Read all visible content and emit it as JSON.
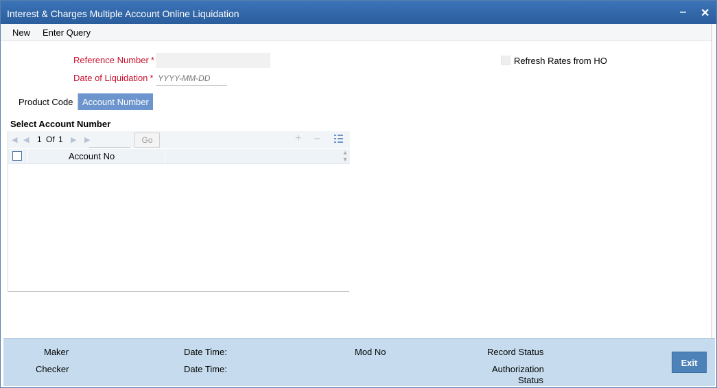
{
  "window": {
    "title": "Interest & Charges Multiple Account Online Liquidation",
    "minimize_label": "‒",
    "close_label": "✕"
  },
  "menu": {
    "new_label": "New",
    "enter_query_label": "Enter Query"
  },
  "form": {
    "reference_number_label": "Reference Number",
    "reference_number_value": "",
    "date_of_liquidation_label": "Date of Liquidation",
    "date_placeholder": "YYYY-MM-DD",
    "required_marker": "*",
    "refresh_rates_label": "Refresh Rates from HO",
    "refresh_rates_checked": false
  },
  "tabs": [
    {
      "label": "Product Code",
      "active": false
    },
    {
      "label": "Account Number",
      "active": true
    }
  ],
  "account_section": {
    "title": "Select Account Number",
    "pager": {
      "current": "1",
      "of_label": "Of",
      "total": "1"
    },
    "go_label": "Go",
    "add_icon": "plus-icon",
    "remove_icon": "minus-icon",
    "columns": [
      "Account No"
    ],
    "rows": []
  },
  "footer": {
    "maker_label": "Maker",
    "checker_label": "Checker",
    "date_time_label_1": "Date Time:",
    "date_time_label_2": "Date Time:",
    "mod_no_label": "Mod No",
    "record_status_label": "Record Status",
    "authorization_label": "Authorization",
    "status_label": "Status",
    "exit_label": "Exit"
  },
  "colors": {
    "titlebar": "#2f66a8",
    "required_label": "#c8102e",
    "active_tab": "#6b95cc",
    "footer_bg": "#c6dcee",
    "exit_button": "#4d82b9"
  }
}
